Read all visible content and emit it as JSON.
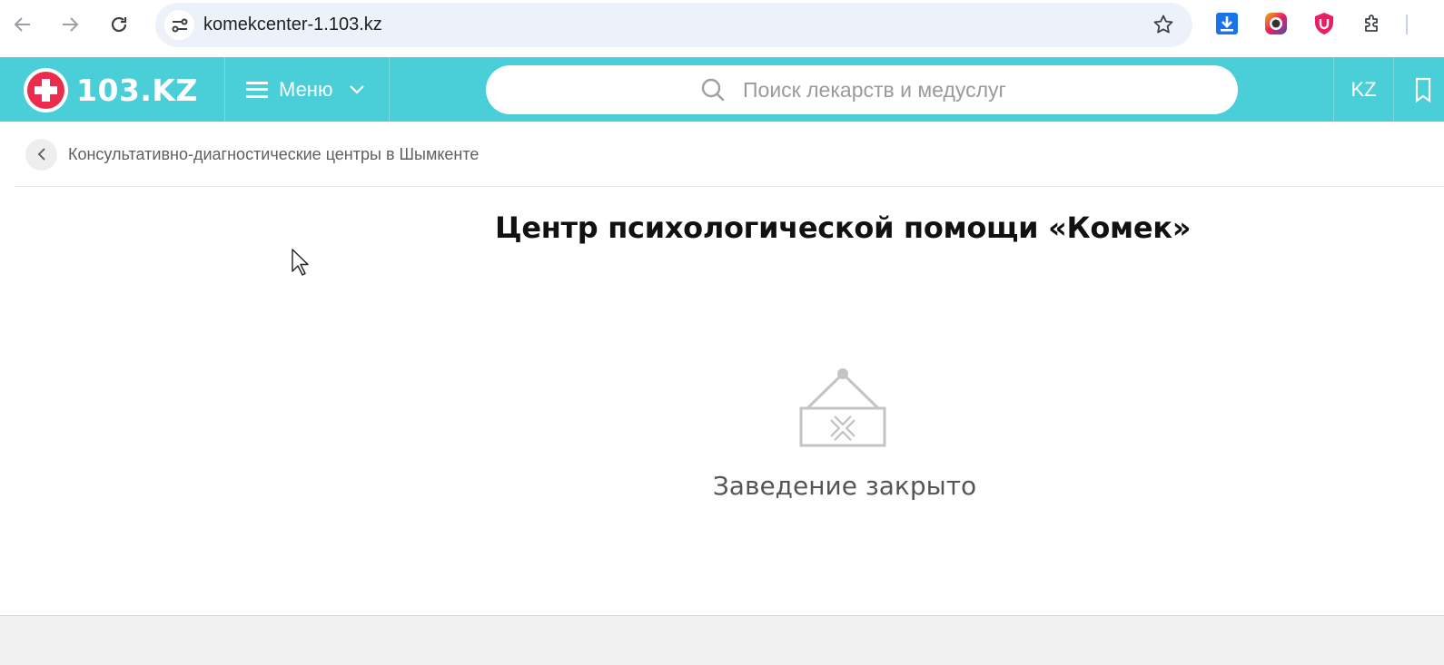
{
  "browser": {
    "url": "komekcenter-1.103.kz",
    "extensions": [
      "download-icon",
      "camera-icon",
      "shield-u-icon",
      "puzzle-icon"
    ]
  },
  "header": {
    "logo_text": "103.KZ",
    "menu_label": "Меню",
    "search_placeholder": "Поиск лекарств и медуслуг",
    "lang_label": "KZ",
    "accent_color": "#4acfd9",
    "logo_color": "#ec2c4d"
  },
  "breadcrumb": {
    "text": "Консультативно-диагностические центры в Шымкенте"
  },
  "main": {
    "title": "Центр психологической помощи «Комек»",
    "status_text": "Заведение закрыто"
  }
}
